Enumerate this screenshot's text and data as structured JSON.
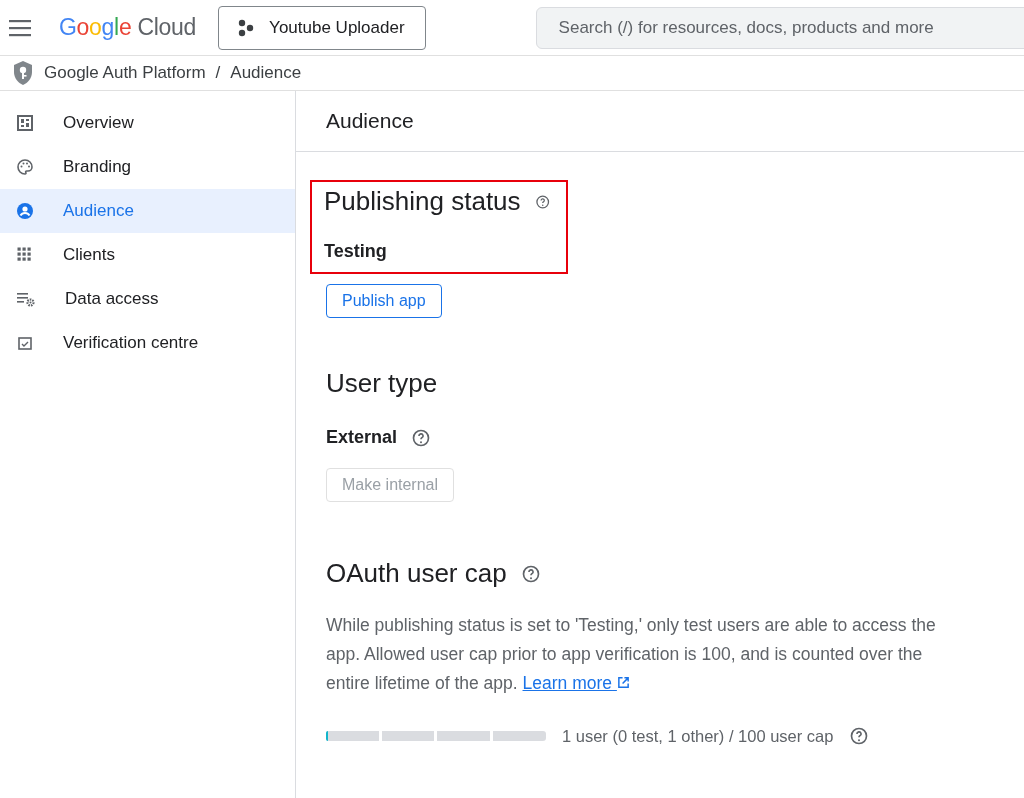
{
  "header": {
    "logo": {
      "brand": "Google",
      "product": "Cloud"
    },
    "project": "Youtube Uploader",
    "search": {
      "placeholder": "Search (/) for resources, docs, products and more"
    }
  },
  "breadcrumb": {
    "items": [
      "Google Auth Platform",
      "Audience"
    ],
    "separator": "/"
  },
  "sidebar": {
    "items": [
      {
        "label": "Overview",
        "selected": false
      },
      {
        "label": "Branding",
        "selected": false
      },
      {
        "label": "Audience",
        "selected": true
      },
      {
        "label": "Clients",
        "selected": false
      },
      {
        "label": "Data access",
        "selected": false
      },
      {
        "label": "Verification centre",
        "selected": false
      }
    ]
  },
  "page_title": "Audience",
  "publishing": {
    "heading": "Publishing status",
    "status": "Testing",
    "highlighted": true,
    "button": {
      "label": "Publish app",
      "disabled": false
    }
  },
  "user_type": {
    "heading": "User type",
    "value": "External",
    "button": {
      "label": "Make internal",
      "disabled": true
    }
  },
  "user_cap": {
    "heading": "OAuth user cap",
    "description": "While publishing status is set to 'Testing,' only test users are able to access the app. Allowed user cap prior to app verification is 100, and is counted over the entire lifetime of the app.",
    "link": "Learn more",
    "level": 0.01,
    "reading": "1 user (0 test, 1 other) / 100 user cap"
  }
}
